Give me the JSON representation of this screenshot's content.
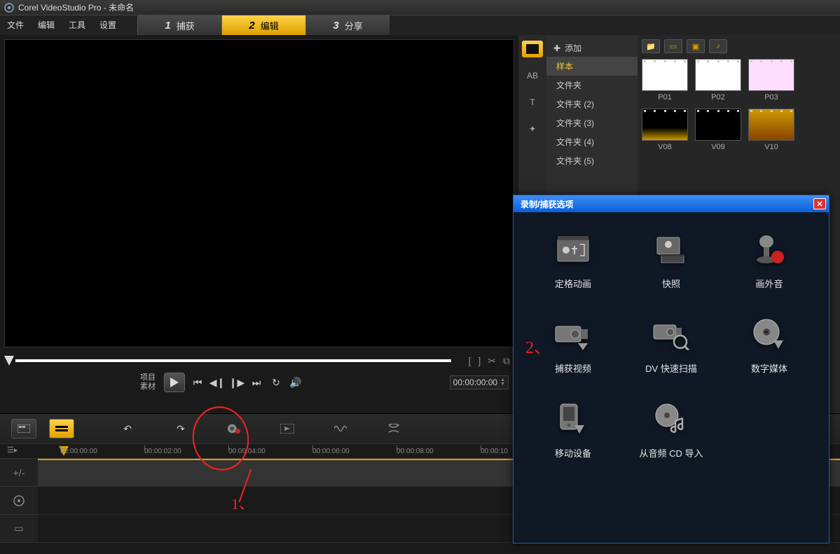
{
  "title": "Corel VideoStudio Pro - 未命名",
  "menu": [
    "文件",
    "编辑",
    "工具",
    "设置"
  ],
  "steps": [
    {
      "num": "1",
      "label": "捕获"
    },
    {
      "num": "2",
      "label": "编辑"
    },
    {
      "num": "3",
      "label": "分享"
    }
  ],
  "preview": {
    "label_project": "项目",
    "label_source": "素材",
    "timecode": "00:00:00:00",
    "bracket_l": "[",
    "bracket_r": "]",
    "scissors": "✂",
    "link": "⧉"
  },
  "library": {
    "add_label": "添加",
    "folders": [
      "样本",
      "文件夹",
      "文件夹 (2)",
      "文件夹 (3)",
      "文件夹 (4)",
      "文件夹 (5)"
    ],
    "thumbs_row1": [
      "P01",
      "P02",
      "P03"
    ],
    "thumbs_row2": [
      "V08",
      "V09",
      "V10"
    ]
  },
  "timeline": {
    "ticks": [
      "00:00:00:00",
      "00:00:02:00",
      "00:00:04:00",
      "00:00:06:00",
      "00:00:08:00",
      "00:00:10"
    ]
  },
  "dialog": {
    "title": "录制/捕获选项",
    "items": [
      "定格动画",
      "快照",
      "画外音",
      "捕获视频",
      "DV 快速扫描",
      "数字媒体",
      "移动设备",
      "从音频 CD 导入"
    ]
  },
  "annotations": {
    "label1": "1、",
    "label2": "2、"
  }
}
